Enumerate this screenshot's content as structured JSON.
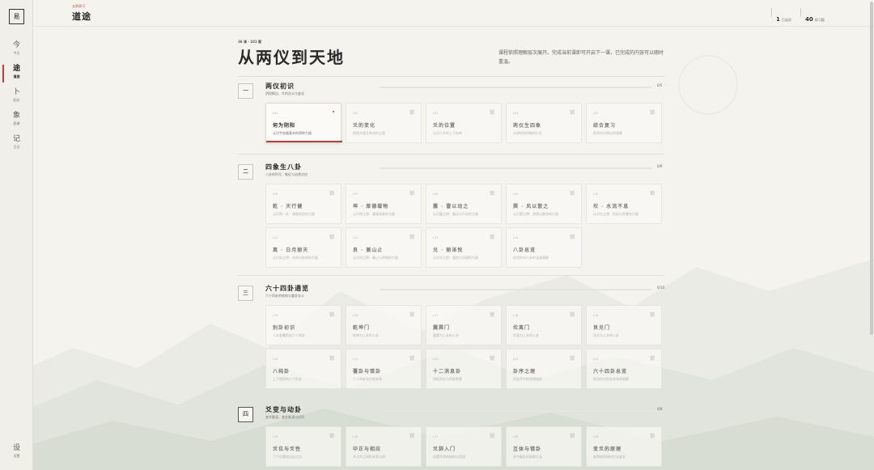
{
  "sidebar": {
    "logo": "易",
    "items": [
      {
        "glyph": "今",
        "label": "今日"
      },
      {
        "glyph": "途",
        "label": "道途"
      },
      {
        "glyph": "卜",
        "label": "起卦"
      },
      {
        "glyph": "象",
        "label": "图谱"
      },
      {
        "glyph": "记",
        "label": "日记"
      }
    ],
    "settings": {
      "glyph": "设",
      "label": "设置"
    }
  },
  "header": {
    "subtitle": "五阶研习",
    "title": "道途",
    "stats": [
      {
        "value": "1",
        "label": "已连续"
      },
      {
        "value": "40",
        "label": "研习篇"
      }
    ]
  },
  "page": {
    "range": "36 课 · 101 题",
    "title": "从两仪到天地",
    "description": "课程依照理解层次展开。完成当前课即可开启下一课，已完成的内容可以随时重温。"
  },
  "lock_glyph": "锁",
  "sections": [
    {
      "number": "一",
      "title": "两仪初识",
      "subtitle": "阴阳概念、爻的含义与变化",
      "progress_label": "0/5",
      "progress": 0,
      "lessons": [
        {
          "id": "L01",
          "title": "何为阴阳",
          "sub": "认识宇宙最基本的两种力量",
          "state": "current"
        },
        {
          "id": "L02",
          "title": "爻的变化",
          "sub": "阴阳爻相互转化的过程",
          "state": "locked"
        },
        {
          "id": "L03",
          "title": "爻的位置",
          "sub": "认识六爻的上下结构",
          "state": "locked"
        },
        {
          "id": "L04",
          "title": "两仪生四象",
          "sub": "从阴阳到四象的衍生",
          "state": "locked"
        },
        {
          "id": "L05",
          "title": "综合复习",
          "sub": "检验你对两仪的理解",
          "state": "locked"
        }
      ]
    },
    {
      "number": "二",
      "title": "四象生八卦",
      "subtitle": "八卦的符号、象征与自然对应",
      "progress_label": "0/9",
      "progress": 0,
      "lessons": [
        {
          "id": "L06",
          "title": "乾 · 天行健",
          "sub": "认识第一卦：刚健创造的力量",
          "state": "locked"
        },
        {
          "id": "L07",
          "title": "坤 · 厚德载物",
          "sub": "认识坤之德：柔顺承载的力量",
          "state": "locked"
        },
        {
          "id": "L08",
          "title": "震 · 雷以动之",
          "sub": "认识震之德：震动与行动的力量",
          "state": "locked"
        },
        {
          "id": "L09",
          "title": "巽 · 风以散之",
          "sub": "认识巽之德：渗透与散布的力量",
          "state": "locked"
        },
        {
          "id": "L10",
          "title": "坎 · 水流不息",
          "sub": "认识坎之德：险陷与智慧的力量",
          "state": "locked"
        },
        {
          "id": "L11",
          "title": "离 · 日月丽天",
          "sub": "认识离之德：光明与依附的力量",
          "state": "locked"
        },
        {
          "id": "L12",
          "title": "艮 · 兼山止",
          "sub": "认识艮之德：静止与界限的力量",
          "state": "locked"
        },
        {
          "id": "L13",
          "title": "兑 · 丽泽悦",
          "sub": "认识兑之德：喜悦与沟通的力量",
          "state": "locked"
        },
        {
          "id": "L14",
          "title": "八卦总览",
          "sub": "检验你对八卦的全部理解",
          "state": "locked"
        }
      ]
    },
    {
      "number": "三",
      "title": "六十四卦通览",
      "subtitle": "六十四卦的结构与重卦含义",
      "progress_label": "0/10",
      "progress": 0,
      "lessons": [
        {
          "id": "L15",
          "title": "别卦初识",
          "sub": "八卦重叠而成六十四卦",
          "state": "locked"
        },
        {
          "id": "L16",
          "title": "乾坤门",
          "sub": "乾坤为上卦的八卦",
          "state": "locked"
        },
        {
          "id": "L17",
          "title": "震巽门",
          "sub": "震巽为上卦的八卦",
          "state": "locked"
        },
        {
          "id": "L18",
          "title": "坎离门",
          "sub": "坎离为上卦的八卦",
          "state": "locked"
        },
        {
          "id": "L19",
          "title": "艮兑门",
          "sub": "艮兑为上卦的八卦",
          "state": "locked"
        },
        {
          "id": "L20",
          "title": "八纯卦",
          "sub": "上下相同的八个别卦",
          "state": "locked"
        },
        {
          "id": "L21",
          "title": "覆卦与错卦",
          "sub": "六十四卦的对称关系",
          "state": "locked"
        },
        {
          "id": "L22",
          "title": "十二消息卦",
          "sub": "阴阳消长与四季更替",
          "state": "locked"
        },
        {
          "id": "L23",
          "title": "卦序之理",
          "sub": "序卦传中的逻辑链条",
          "state": "locked"
        },
        {
          "id": "L24",
          "title": "六十四卦总览",
          "sub": "检验你对别卦体系的理解",
          "state": "locked"
        }
      ]
    },
    {
      "number": "四",
      "title": "爻变与动卦",
      "subtitle": "变爻解读、变卦推演与应用",
      "progress_label": "0/8",
      "progress": 0,
      "lessons": [
        {
          "id": "L25",
          "title": "爻位与爻性",
          "sub": "六个位置的吉凶之分",
          "state": "locked"
        },
        {
          "id": "L26",
          "title": "中正与相应",
          "sub": "爻与爻之间的关系法则",
          "state": "locked"
        },
        {
          "id": "L27",
          "title": "爻辞入门",
          "sub": "读懂爻辞的结构与用语",
          "state": "locked"
        },
        {
          "id": "L28",
          "title": "互体与错卦",
          "sub": "卦中藏卦的观察方法",
          "state": "locked"
        },
        {
          "id": "L29",
          "title": "变爻的原理",
          "sub": "老阴老阳如何生出变卦",
          "state": "locked"
        }
      ]
    }
  ]
}
